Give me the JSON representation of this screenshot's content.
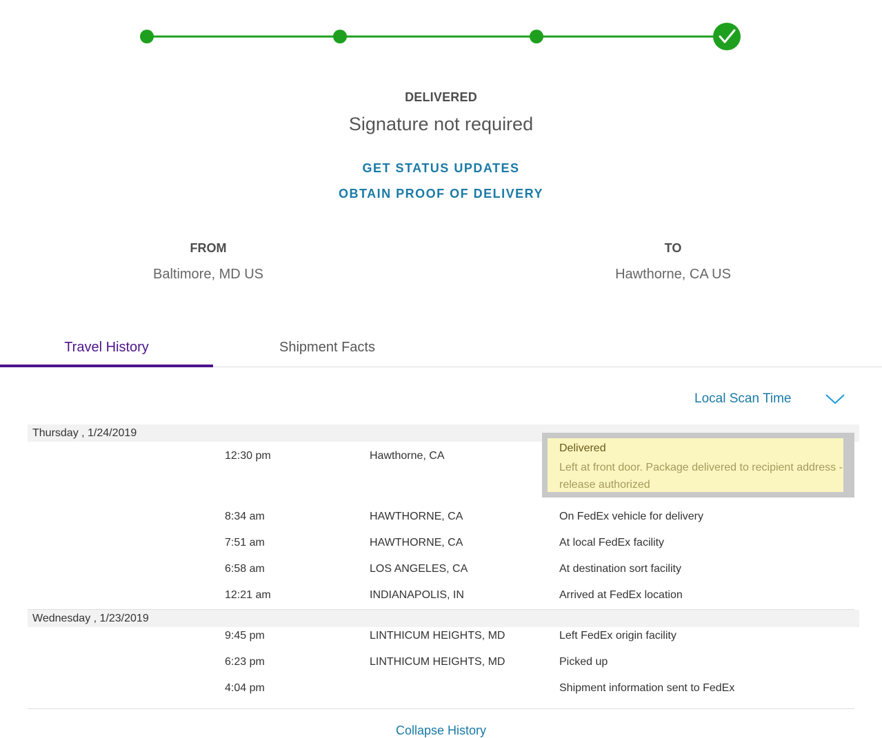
{
  "progress": {
    "steps": 4,
    "completed_steps": 4,
    "color": "#1ea01e",
    "current_step_icon": "check-icon"
  },
  "status": {
    "label": "DELIVERED",
    "sub": "Signature not required"
  },
  "links": {
    "status_updates": "GET STATUS UPDATES",
    "proof_of_delivery": "OBTAIN PROOF OF DELIVERY"
  },
  "shipment": {
    "from_label": "FROM",
    "from_value": "Baltimore, MD US",
    "to_label": "TO",
    "to_value": "Hawthorne, CA US"
  },
  "tabs": [
    {
      "label": "Travel History",
      "active": true
    },
    {
      "label": "Shipment Facts",
      "active": false
    }
  ],
  "scan_time": {
    "selected": "Local Scan Time",
    "icon": "chevron-down-icon"
  },
  "history": {
    "days": [
      {
        "date": "Thursday , 1/24/2019",
        "events": [
          {
            "time": "12:30 pm",
            "location": "Hawthorne, CA",
            "description": "Delivered",
            "detail": "Left at front door. Package delivered to recipient address - release authorized"
          },
          {
            "time": "8:34 am",
            "location": "HAWTHORNE, CA",
            "description": "On FedEx vehicle for delivery"
          },
          {
            "time": "7:51 am",
            "location": "HAWTHORNE, CA",
            "description": "At local FedEx facility"
          },
          {
            "time": "6:58 am",
            "location": "LOS ANGELES, CA",
            "description": "At destination sort facility"
          },
          {
            "time": "12:21 am",
            "location": "INDIANAPOLIS, IN",
            "description": "Arrived at FedEx location"
          }
        ]
      },
      {
        "date": "Wednesday , 1/23/2019",
        "events": [
          {
            "time": "9:45 pm",
            "location": "LINTHICUM HEIGHTS, MD",
            "description": "Left FedEx origin facility"
          },
          {
            "time": "6:23 pm",
            "location": "LINTHICUM HEIGHTS, MD",
            "description": "Picked up"
          },
          {
            "time": "4:04 pm",
            "location": "",
            "description": "Shipment information sent to FedEx"
          }
        ]
      }
    ]
  },
  "bottom_link": "Collapse History"
}
